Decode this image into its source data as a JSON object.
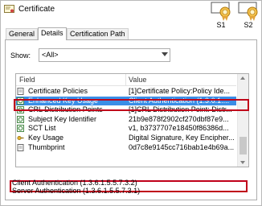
{
  "window": {
    "title": "Certificate"
  },
  "badges": [
    {
      "label": "S1"
    },
    {
      "label": "S2"
    }
  ],
  "tabs": [
    {
      "label": "General"
    },
    {
      "label": "Details"
    },
    {
      "label": "Certification Path"
    }
  ],
  "show": {
    "label": "Show:",
    "value": "<All>"
  },
  "list": {
    "columns": {
      "field": "Field",
      "value": "Value"
    },
    "rows": [
      {
        "field": "Certificate Policies",
        "value": "[1]Certificate Policy:Policy Ide..."
      },
      {
        "field": "Enhanced Key Usage",
        "value": "Client Authentication (1.3.6.1...."
      },
      {
        "field": "CRL Distribution Points",
        "value": "[1]CRL Distribution Point: Distr..."
      },
      {
        "field": "Subject Key Identifier",
        "value": "21b9e878f2902cf270dbf87e9..."
      },
      {
        "field": "SCT List",
        "value": "v1, b3737707e18450f86386d..."
      },
      {
        "field": "Key Usage",
        "value": "Digital Signature, Key Encipher..."
      },
      {
        "field": "Thumbprint",
        "value": "0d7c8e9145cc716bab1e4b69a..."
      }
    ],
    "selected_index": 1
  },
  "detail": {
    "lines": [
      "Client Authentication (1.3.6.1.5.5.7.3.2)",
      "Server Authentication (1.3.6.1.5.5.7.3.1)"
    ]
  },
  "colors": {
    "selection": "#3a8ee6",
    "highlight": "#c0001a",
    "badge_ribbon": "#e2a43a"
  }
}
